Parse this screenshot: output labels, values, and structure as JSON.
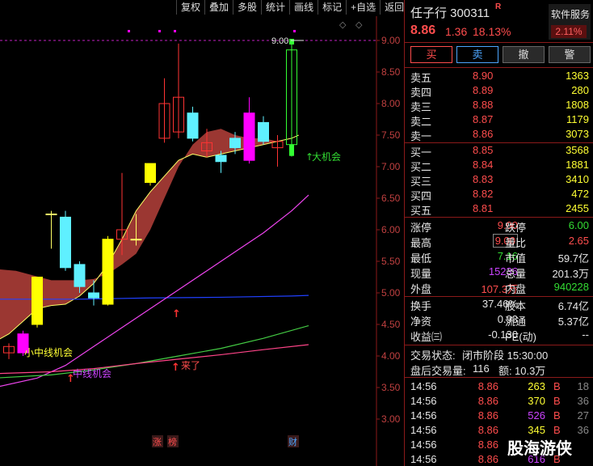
{
  "toolbar": [
    "复权",
    "叠加",
    "多股",
    "统计",
    "画线",
    "标记",
    "+自选",
    "返回"
  ],
  "chart": {
    "y_ticks": [
      "9.00",
      "8.50",
      "8.00",
      "7.50",
      "7.00",
      "6.50",
      "6.00",
      "5.50",
      "5.00",
      "4.50",
      "4.00",
      "3.50",
      "3.00"
    ],
    "high_marker_label": "9.00",
    "annotations": {
      "big_chance": "大机会",
      "small_mid_chance": "小中线机会",
      "mid_chance": "中线机会",
      "coming": "来了"
    },
    "bottom_tags": [
      "涨",
      "榜",
      "财"
    ],
    "colors": {
      "up_candle": "#ff3333",
      "down_candle": "#5ff0ff",
      "yellow_candle": "#ffff00",
      "magenta_candle": "#ff00ff",
      "band_fill": "#a33a35",
      "ma_blue": "#2040ff",
      "ma_magenta": "#ee44ee",
      "ma_green": "#44cc44",
      "ma_pink": "#ff4488"
    }
  },
  "quote": {
    "name_code": "任子行 300311",
    "tag": "R",
    "sector": "软件服务",
    "sector_pct": "2.11%",
    "price": "8.86",
    "change": "1.36",
    "change_pct": "18.13%"
  },
  "buttons": {
    "buy": "买",
    "sell": "卖",
    "cancel": "撤",
    "alert": "警"
  },
  "asks": [
    {
      "label": "卖五",
      "price": "8.90",
      "vol": "1363"
    },
    {
      "label": "卖四",
      "price": "8.89",
      "vol": "280"
    },
    {
      "label": "卖三",
      "price": "8.88",
      "vol": "1808"
    },
    {
      "label": "卖二",
      "price": "8.87",
      "vol": "1179"
    },
    {
      "label": "卖一",
      "price": "8.86",
      "vol": "3073"
    }
  ],
  "bids": [
    {
      "label": "买一",
      "price": "8.85",
      "vol": "3568"
    },
    {
      "label": "买二",
      "price": "8.84",
      "vol": "1881"
    },
    {
      "label": "买三",
      "price": "8.83",
      "vol": "3410"
    },
    {
      "label": "买四",
      "price": "8.82",
      "vol": "472"
    },
    {
      "label": "买五",
      "price": "8.81",
      "vol": "2455"
    }
  ],
  "stats1": [
    {
      "l1": "涨停",
      "v1": "9.00",
      "c1": "red",
      "l2": "跌停",
      "v2": "6.00",
      "c2": "green"
    },
    {
      "l1": "最高",
      "v1": "9.00",
      "c1": "red",
      "l2": "量比",
      "v2": "2.65",
      "c2": "red"
    },
    {
      "l1": "最低",
      "v1": "7.16",
      "c1": "green",
      "l2": "市值",
      "v2": "59.7亿",
      "c2": "white"
    },
    {
      "l1": "现量",
      "v1": "15236",
      "c1": "purple",
      "l2": "总量",
      "v2": "201.3万",
      "c2": "white"
    },
    {
      "l1": "外盘",
      "v1": "107.3万",
      "c1": "red",
      "l2": "内盘",
      "v2": "940228",
      "c2": "green"
    }
  ],
  "stats2": [
    {
      "l1": "换手",
      "v1": "37.46%",
      "c1": "white",
      "l2": "股本",
      "v2": "6.74亿",
      "c2": "white"
    },
    {
      "l1": "净资",
      "v1": "0.93",
      "c1": "white",
      "l2": "流通",
      "v2": "5.37亿",
      "c2": "white"
    },
    {
      "l1": "收益㈢",
      "v1": "-0.130",
      "c1": "white",
      "l2": "PE(动)",
      "v2": "--",
      "c2": "white"
    }
  ],
  "trade_status": {
    "label": "交易状态:",
    "value": "闭市阶段 15:30:00"
  },
  "after_hours": {
    "label": "盘后交易量:",
    "vol": "116",
    "amount_label": "额:",
    "amount": "10.3万"
  },
  "ticks": [
    {
      "time": "14:56",
      "price": "8.86",
      "vol": "263",
      "vc": "yellow",
      "bs": "B",
      "n": "18"
    },
    {
      "time": "14:56",
      "price": "8.86",
      "vol": "370",
      "vc": "yellow",
      "bs": "B",
      "n": "36"
    },
    {
      "time": "14:56",
      "price": "8.86",
      "vol": "526",
      "vc": "purple",
      "bs": "B",
      "n": "27"
    },
    {
      "time": "14:56",
      "price": "8.86",
      "vol": "345",
      "vc": "yellow",
      "bs": "B",
      "n": "36"
    },
    {
      "time": "14:56",
      "price": "8.86",
      "vol": "",
      "vc": "yellow",
      "bs": "",
      "n": ""
    },
    {
      "time": "14:56",
      "price": "8.86",
      "vol": "616",
      "vc": "purple",
      "bs": "B",
      "n": ""
    }
  ],
  "watermark": "股海游侠"
}
